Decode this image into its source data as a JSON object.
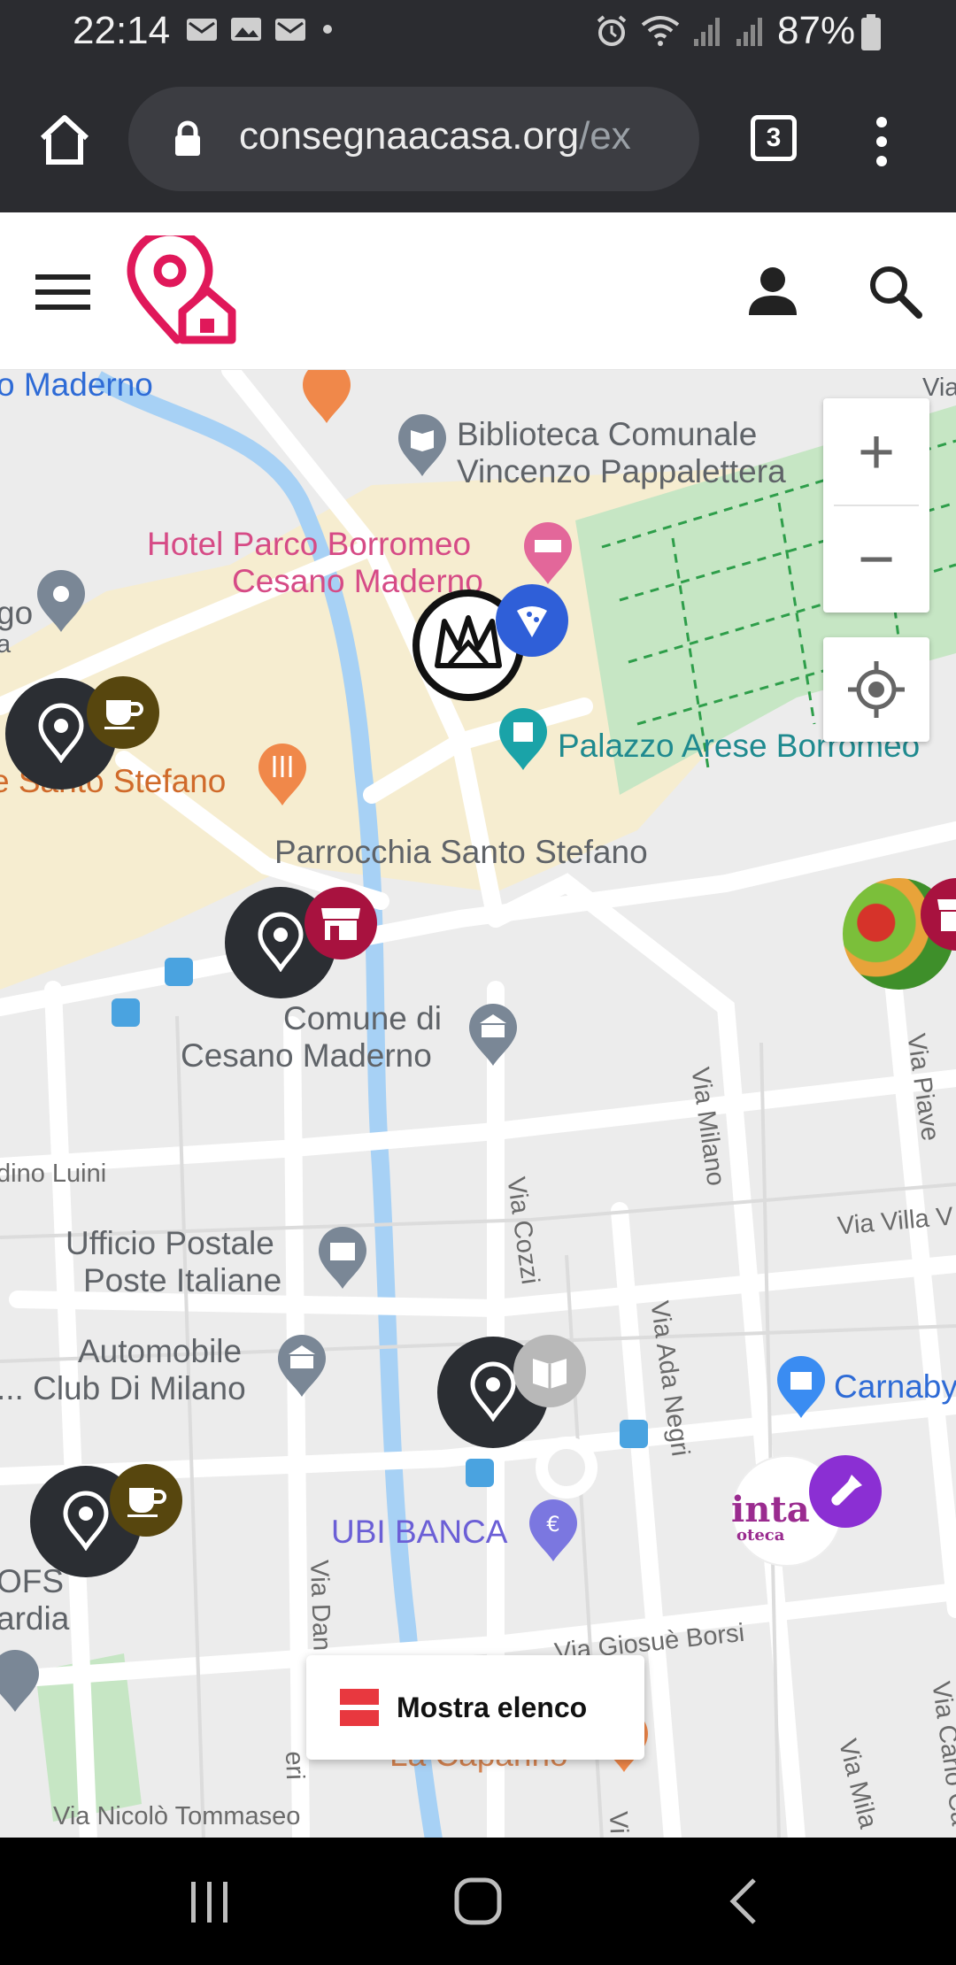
{
  "status_bar": {
    "time": "22:14",
    "battery": "87%",
    "icons": [
      "gmail-icon",
      "image-icon",
      "gmail-icon",
      "dot-icon",
      "alarm-icon",
      "wifi-icon",
      "signal-icon",
      "signal-icon",
      "battery-icon"
    ]
  },
  "browser": {
    "url_main": "consegnaacasa.org",
    "url_dim": "/ex",
    "tab_count": "3"
  },
  "site": {
    "brand_color": "#e0185a"
  },
  "map": {
    "labels": {
      "maderno_top": "o Maderno",
      "biblioteca_1": "Biblioteca Comunale",
      "biblioteca_2": "Vincenzo Pappalettera",
      "hotel_1": "Hotel Parco Borromeo",
      "hotel_2": "Cesano Maderno",
      "go": "go",
      "a": "a",
      "palazzo": "Palazzo Arese Borromeo",
      "santo_stefano_rest": "e Santo Stefano",
      "parrocchia": "Parrocchia Santo Stefano",
      "comune_1": "Comune di",
      "comune_2": "Cesano Maderno",
      "via_milano": "Via Milano",
      "via_piave": "Via Piave",
      "luini": "dino Luini",
      "via_cozzi": "Via Cozzi",
      "via_villa": "Via Villa V",
      "ufficio_1": "Ufficio Postale",
      "ufficio_2": "Poste Italiane",
      "automobile_1": "Automobile",
      "automobile_2": "... Club Di Milano",
      "via_ada_negri": "Via Ada Negri",
      "carnaby": "Carnaby",
      "ubi": "UBI BANCA",
      "ofs": "OFS",
      "ardia": "ardia",
      "via_dan": "Via Dan",
      "via_giosue": "Via Giosuè Borsi",
      "via_carlo": "Via Carlo Ca",
      "via_mila": "Via Mila",
      "via_nicolo": "Via Nicolò Tommaseo",
      "la_capanna": "La Capanno",
      "eri": "eri",
      "vi": "Vi",
      "via_top_right": "Via",
      "vintage_1": "inta",
      "vintage_2": "oteca"
    },
    "zoom_in": "+",
    "zoom_out": "−",
    "list_button": "Mostra elenco"
  }
}
